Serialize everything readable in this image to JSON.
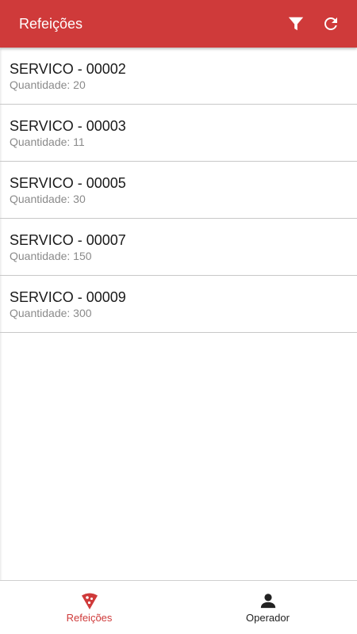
{
  "colors": {
    "primary": "#cf3a3a",
    "text_primary": "#1a1a1a",
    "text_secondary": "#8a8a8a",
    "divider": "#c8c8c8",
    "nav_active": "#cf3a3a",
    "nav_inactive": "#222222"
  },
  "appbar": {
    "title": "Refeições",
    "actions": [
      {
        "icon": "filter-icon"
      },
      {
        "icon": "refresh-icon"
      }
    ]
  },
  "list": {
    "items": [
      {
        "title": "SERVICO - 00002",
        "subtitle": "Quantidade: 20"
      },
      {
        "title": "SERVICO - 00003",
        "subtitle": "Quantidade: 11"
      },
      {
        "title": "SERVICO - 00005",
        "subtitle": "Quantidade: 30"
      },
      {
        "title": "SERVICO - 00007",
        "subtitle": "Quantidade: 150"
      },
      {
        "title": "SERVICO - 00009",
        "subtitle": "Quantidade: 300"
      }
    ]
  },
  "bottom_nav": {
    "items": [
      {
        "label": "Refeições",
        "icon": "pizza-icon",
        "active": true
      },
      {
        "label": "Operador",
        "icon": "person-icon",
        "active": false
      }
    ]
  }
}
